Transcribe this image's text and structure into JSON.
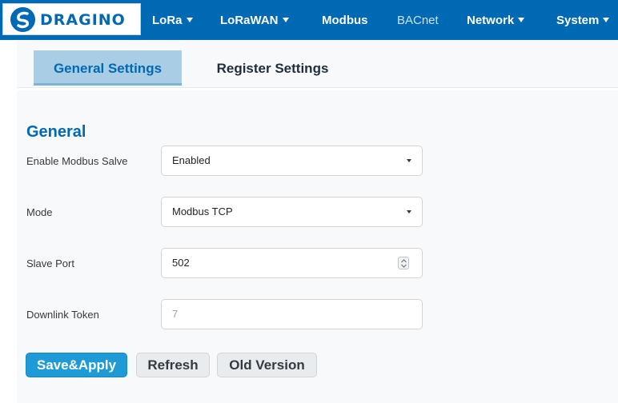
{
  "brand": {
    "logo_text": "DRAGINO",
    "logo_icon": "dragino-swirl-icon",
    "primary_color": "#0069b4"
  },
  "nav": {
    "items": [
      {
        "label": "LoRa",
        "dropdown": true
      },
      {
        "label": "LoRaWAN",
        "dropdown": true
      },
      {
        "label": "Modbus",
        "dropdown": false
      },
      {
        "label": "BACnet",
        "dropdown": false
      },
      {
        "label": "Network",
        "dropdown": true
      },
      {
        "label": "System",
        "dropdown": true
      }
    ]
  },
  "tabs": [
    {
      "label": "General Settings",
      "active": true
    },
    {
      "label": "Register Settings",
      "active": false
    }
  ],
  "section": {
    "title": "General"
  },
  "form": {
    "enable_modbus": {
      "label": "Enable Modbus Salve",
      "value": "Enabled",
      "options_visible": [
        "Enabled"
      ]
    },
    "mode": {
      "label": "Mode",
      "value": "Modbus TCP",
      "options_visible": [
        "Modbus TCP"
      ]
    },
    "slave_port": {
      "label": "Slave Port",
      "value": "502"
    },
    "downlink_token": {
      "label": "Downlink Token",
      "placeholder": "7"
    }
  },
  "buttons": {
    "save_apply": "Save&Apply",
    "refresh": "Refresh",
    "old_version": "Old Version"
  }
}
